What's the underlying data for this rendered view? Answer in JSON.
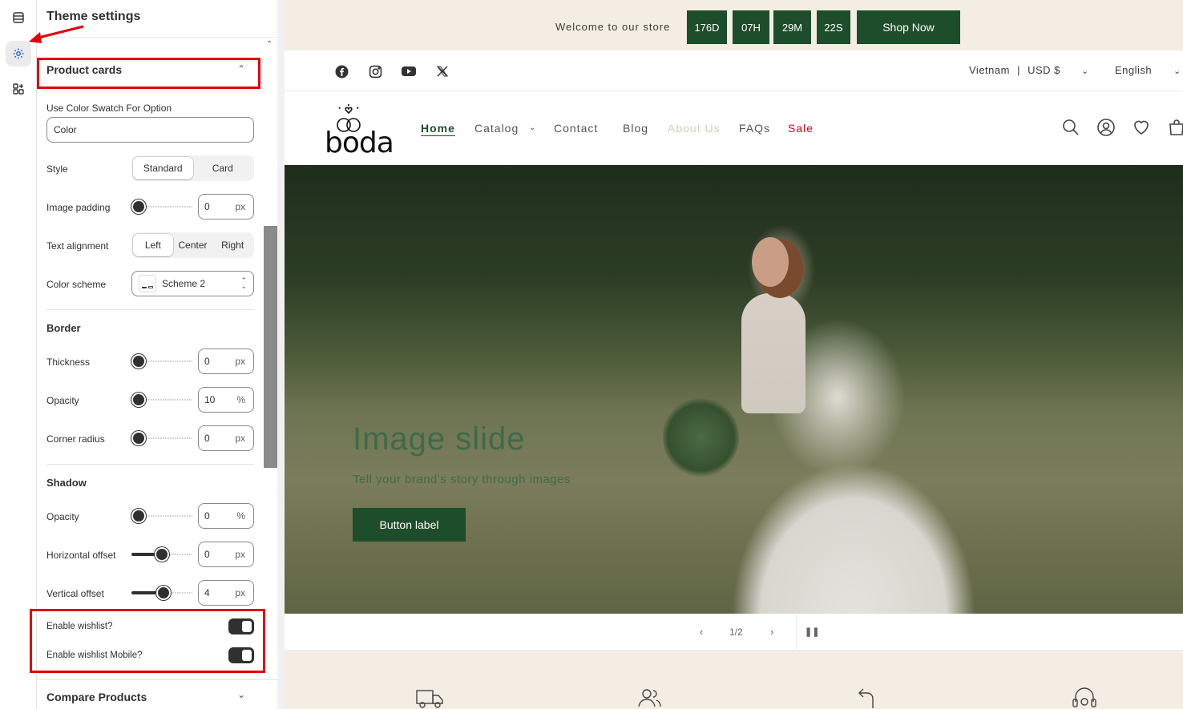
{
  "sidebar": {
    "title": "Theme settings",
    "section": "Product cards",
    "color_swatch_label": "Use Color Swatch For Option",
    "color_swatch_value": "Color",
    "style_label": "Style",
    "style_options": [
      "Standard",
      "Card"
    ],
    "style_selected": "Standard",
    "image_padding_label": "Image padding",
    "image_padding_value": "0",
    "text_alignment_label": "Text alignment",
    "text_alignment_options": [
      "Left",
      "Center",
      "Right"
    ],
    "text_alignment_selected": "Left",
    "color_scheme_label": "Color scheme",
    "color_scheme_value": "Scheme 2",
    "border_title": "Border",
    "thickness_label": "Thickness",
    "thickness_value": "0",
    "border_opacity_label": "Opacity",
    "border_opacity_value": "10",
    "corner_radius_label": "Corner radius",
    "corner_radius_value": "0",
    "shadow_title": "Shadow",
    "shadow_opacity_label": "Opacity",
    "shadow_opacity_value": "0",
    "h_offset_label": "Horizontal offset",
    "h_offset_value": "0",
    "v_offset_label": "Vertical offset",
    "v_offset_value": "4",
    "wishlist_label": "Enable wishlist?",
    "wishlist_enabled": true,
    "wishlist_mobile_label": "Enable wishlist Mobile?",
    "wishlist_mobile_enabled": true,
    "compare_section": "Compare Products",
    "unit_px": "px",
    "unit_pct": "%"
  },
  "slider_levels": {
    "image_padding": 0.0,
    "thickness": 0.0,
    "border_opacity": 0.1,
    "corner_radius": 0.0,
    "shadow_opacity": 0.0,
    "h_offset": 0.5,
    "v_offset": 0.52
  },
  "store": {
    "announcement": "Welcome to our store",
    "countdown": [
      "176D",
      "07H",
      "29M",
      "22S"
    ],
    "shop_now": "Shop Now",
    "country": "Vietnam",
    "currency_sep": "|",
    "currency": "USD $",
    "language": "English",
    "logo_text": "boda",
    "nav": [
      "Home",
      "Catalog",
      "Contact",
      "Blog",
      "About Us",
      "FAQs",
      "Sale"
    ],
    "hero_title": "Image slide",
    "hero_subtitle": "Tell your brand's story through images",
    "hero_button": "Button label",
    "slide_counter": "1/2"
  },
  "colors": {
    "accent_green": "#1e4d2b",
    "announcement_bg": "#f3ede3",
    "highlight_red": "#e0000b",
    "sale_red": "#d0021b"
  }
}
